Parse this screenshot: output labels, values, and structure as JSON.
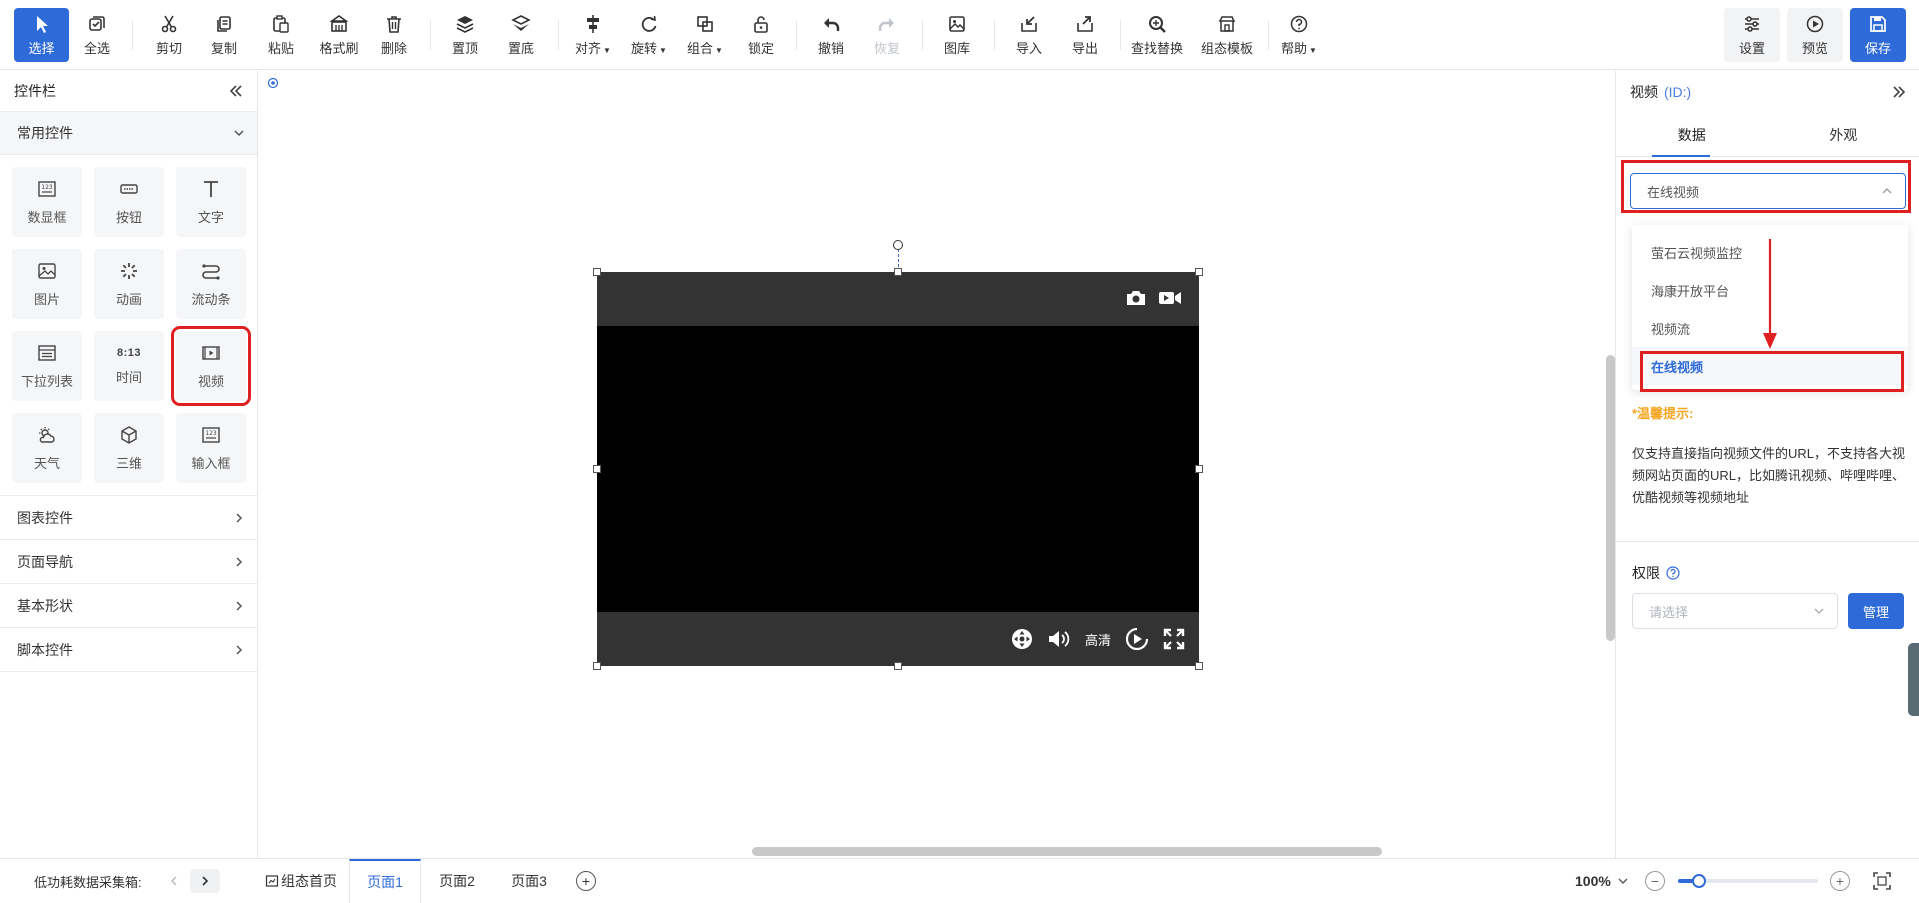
{
  "toolbar": {
    "select": "选择",
    "select_all": "全选",
    "cut": "剪切",
    "copy": "复制",
    "paste": "粘贴",
    "format_brush": "格式刷",
    "delete": "删除",
    "bring_top": "置顶",
    "send_bottom": "置底",
    "align": "对齐",
    "rotate": "旋转",
    "group": "组合",
    "lock": "锁定",
    "undo": "撤销",
    "redo": "恢复",
    "gallery": "图库",
    "import": "导入",
    "export": "导出",
    "find_replace": "查找替换",
    "template": "组态模板",
    "help": "帮助",
    "settings": "设置",
    "preview": "预览",
    "save": "保存"
  },
  "left_panel": {
    "title": "控件栏",
    "common_section": "常用控件",
    "widgets": [
      "数显框",
      "按钮",
      "文字",
      "图片",
      "动画",
      "流动条",
      "下拉列表",
      "时间",
      "视频",
      "天气",
      "三维",
      "输入框"
    ],
    "time_icon_text": "8:13",
    "sections": [
      "图表控件",
      "页面导航",
      "基本形状",
      "脚本控件"
    ]
  },
  "video_widget": {
    "quality": "高清"
  },
  "right_panel": {
    "title": "视频",
    "id_label": "(ID:)",
    "tabs": [
      "数据",
      "外观"
    ],
    "source_select": "在线视频",
    "dropdown_options": [
      "萤石云视频监控",
      "海康开放平台",
      "视频流",
      "在线视频"
    ],
    "tip_title": "*温馨提示:",
    "tip_body": "仅支持直接指向视频文件的URL，不支持各大视频网站页面的URL，比如腾讯视频、哔哩哔哩、优酷视频等视频地址",
    "permission_label": "权限",
    "permission_placeholder": "请选择",
    "manage_button": "管理"
  },
  "bottom_bar": {
    "device_label": "低功耗数据采集箱:",
    "home_tab": "组态首页",
    "pages": [
      "页面1",
      "页面2",
      "页面3"
    ],
    "zoom": "100%",
    "zoom_value": 0.15
  },
  "colors": {
    "accent": "#2f6bd8",
    "highlight": "#e02020",
    "tip": "#f5a623"
  }
}
